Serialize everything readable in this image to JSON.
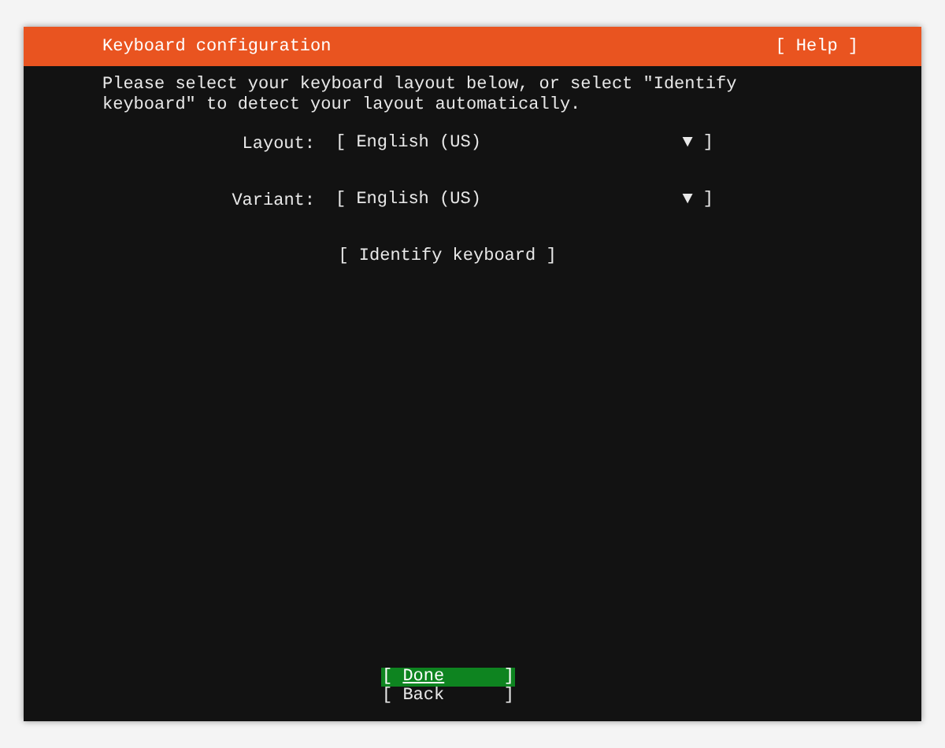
{
  "header": {
    "title": "Keyboard configuration",
    "help": "[ Help ]"
  },
  "intro": "Please select your keyboard layout below, or select \"Identify keyboard\" to detect your layout automatically.",
  "fields": [
    {
      "label": "Layout:",
      "open": "[",
      "value": "English (US)",
      "arrow": "▼",
      "close": "]"
    },
    {
      "label": "Variant:",
      "open": "[",
      "value": "English (US)",
      "arrow": "▼",
      "close": "]"
    }
  ],
  "identify": "[ Identify keyboard ]",
  "buttons": [
    {
      "open": "[",
      "label": "Done",
      "close": "]",
      "selected": true
    },
    {
      "open": "[",
      "label": "Back",
      "close": "]",
      "selected": false
    }
  ]
}
